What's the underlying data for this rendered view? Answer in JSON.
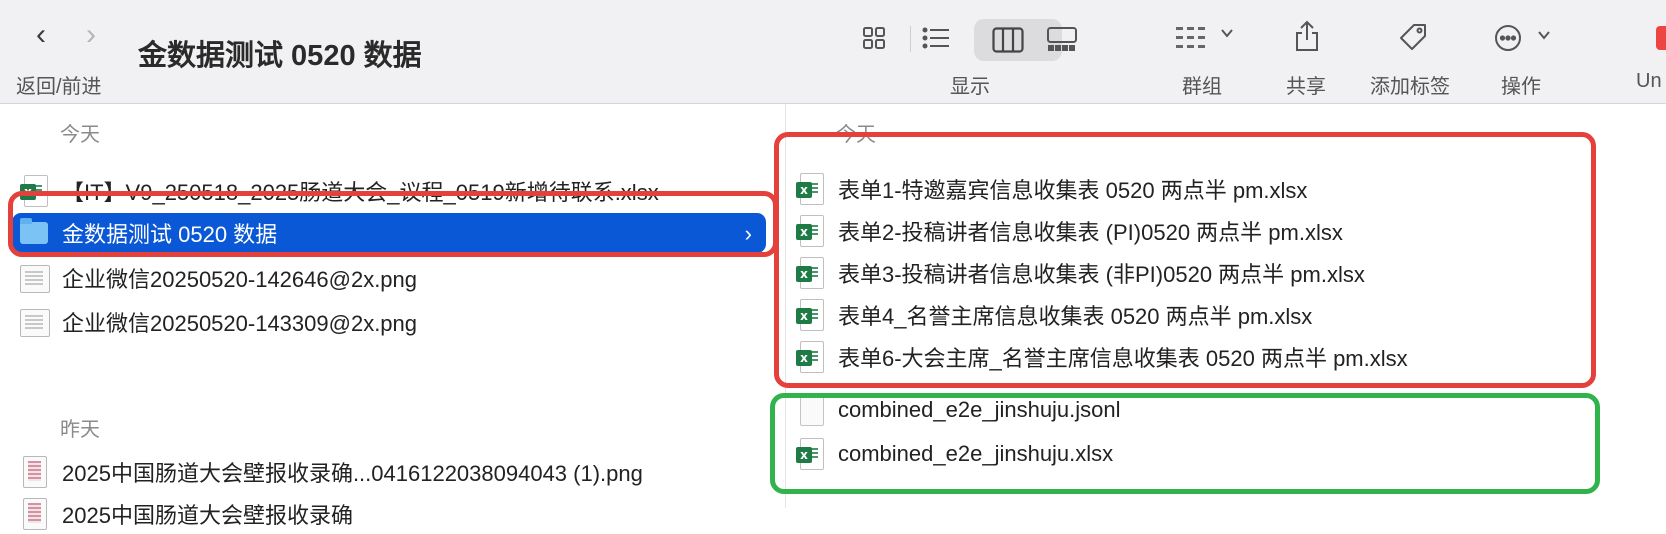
{
  "toolbar": {
    "nav_back_glyph": "‹",
    "nav_forward_glyph": "›",
    "nav_caption": "返回/前进",
    "window_title": "金数据测试 0520 数据",
    "display_label": "显示",
    "group_label": "群组",
    "share_label": "共享",
    "tag_label": "添加标签",
    "action_label": "操作",
    "overflow_label": "Un",
    "icons": [
      "icon-view-grid",
      "list-view-icon",
      "column-view-icon",
      "gallery-view-icon",
      "group-icon",
      "share-icon",
      "tag-icon",
      "more-actions-icon"
    ]
  },
  "left_column": {
    "today_header": "今天",
    "items": [
      {
        "name": "【IT】V9_250518_2025肠道大会_议程_0519新增待联系.xlsx",
        "icon": "xlsx"
      },
      {
        "name": "金数据测试 0520 数据",
        "icon": "folder",
        "selected": true
      },
      {
        "name": "企业微信20250520-142646@2x.png",
        "icon": "png"
      },
      {
        "name": "企业微信20250520-143309@2x.png",
        "icon": "png"
      }
    ],
    "yesterday_header": "昨天",
    "yesterday_items": [
      {
        "name": "2025中国肠道大会壁报收录确...0416122038094043 (1).png",
        "icon": "png"
      },
      {
        "name": "2025中国肠道大会壁报收录确",
        "icon": "png"
      }
    ]
  },
  "right_column": {
    "today_header": "今天",
    "items": [
      {
        "name": "表单1-特邀嘉宾信息收集表 0520 两点半 pm.xlsx",
        "icon": "xlsx"
      },
      {
        "name": "表单2-投稿讲者信息收集表 (PI)0520 两点半 pm.xlsx",
        "icon": "xlsx"
      },
      {
        "name": "表单3-投稿讲者信息收集表 (非PI)0520 两点半 pm.xlsx",
        "icon": "xlsx"
      },
      {
        "name": "表单4_名誉主席信息收集表 0520 两点半 pm.xlsx",
        "icon": "xlsx"
      },
      {
        "name": "表单6-大会主席_名誉主席信息收集表 0520 两点半 pm.xlsx",
        "icon": "xlsx"
      },
      {
        "name": "combined_e2e_jinshuju.jsonl",
        "icon": "document"
      },
      {
        "name": "combined_e2e_jinshuju.xlsx",
        "icon": "xlsx"
      }
    ]
  },
  "colors": {
    "selection": "#0a58d6",
    "annotation_red": "#e5413c",
    "annotation_green": "#2fb34a",
    "excel_green": "#1e7b45",
    "folder_blue": "#7cc3f5"
  },
  "excel_badge_letter": "x",
  "chevron_glyph": "›"
}
